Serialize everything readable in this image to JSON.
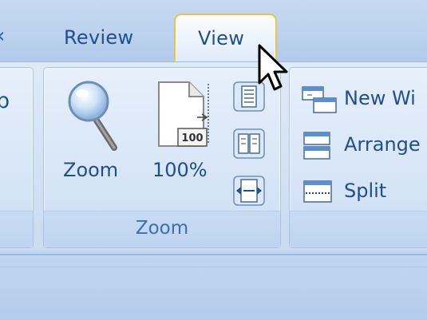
{
  "tabs": {
    "review_label": "Review",
    "view_label": "View"
  },
  "left_group": {
    "fragment": "p"
  },
  "zoom_group": {
    "label": "Zoom",
    "zoom_button_label": "Zoom",
    "hundred_button_label": "100%",
    "page_icon_badge": "100",
    "icons": [
      "magnifier-icon",
      "page-100-icon",
      "one-page-icon",
      "two-pages-icon",
      "page-width-icon"
    ]
  },
  "window_group": {
    "new_window_label": "New Wi",
    "arrange_label": "Arrange",
    "split_label": "Split",
    "icons": [
      "new-window-icon",
      "arrange-all-icon",
      "split-icon"
    ]
  },
  "colors": {
    "tab_text": "#1f4f8f",
    "group_label": "#3c6fae",
    "active_tab_border": "#e6c25b",
    "ribbon_bg": "#d8e6f7"
  }
}
